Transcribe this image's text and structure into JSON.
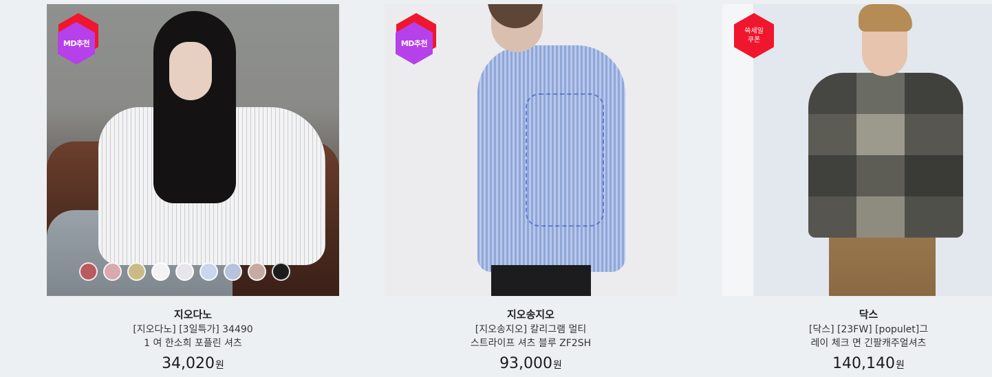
{
  "products": [
    {
      "brand": "지오다노",
      "name": "[지오다노] [3일특가] 34490\n1 여 한소희 포플린 셔츠",
      "price": "34,020",
      "currency": "원",
      "badge": "MD추천",
      "badge_color": "#b640ea",
      "swatches": [
        "#b85a5e",
        "#d9a9ad",
        "#c9bb86",
        "#f3f3f3",
        "#e8e6ea",
        "#c9d6ee",
        "#b7c3dc",
        "#c7aaa1",
        "#1c1c1c"
      ]
    },
    {
      "brand": "지오송지오",
      "name": "[지오송지오] 칼리그램 멀티\n스트라이프 셔츠 블루 ZF2SH",
      "price": "93,000",
      "currency": "원",
      "badge": "MD추천",
      "badge_color": "#b640ea"
    },
    {
      "brand": "닥스",
      "name": "[닥스] [23FW] [populet]그\n레이 체크 면 긴팔캐주얼셔츠",
      "price": "140,140",
      "currency": "원",
      "badge": "쓱세일\n쿠폰",
      "badge_color": "#f0162d"
    }
  ]
}
